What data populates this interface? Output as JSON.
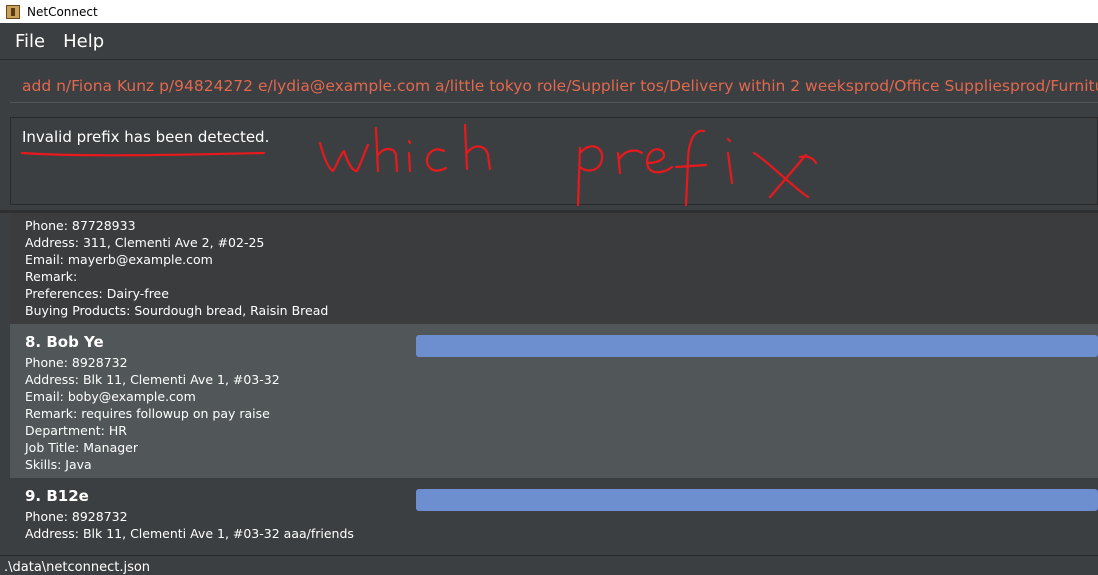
{
  "window": {
    "title": "NetConnect",
    "icon": "netconnect-app-icon"
  },
  "menu": {
    "file": "File",
    "help": "Help"
  },
  "command": {
    "value": "add n/Fiona Kunz p/94824272 e/lydia@example.com a/little tokyo role/Supplier tos/Delivery within 2 weeksprod/Office Suppliesprod/Furniture"
  },
  "result": {
    "message": "Invalid prefix has been detected."
  },
  "annotation": {
    "handwritten": "which prefix"
  },
  "persons": [
    {
      "phone": "Phone: 87728933",
      "address": "Address: 311, Clementi Ave 2, #02-25",
      "email": "Email: mayerb@example.com",
      "remark": "Remark:",
      "preferences": "Preferences: Dairy-free",
      "buying": "Buying Products: Sourdough bread, Raisin Bread"
    },
    {
      "name": "8.  Bob Ye",
      "phone": "Phone: 8928732",
      "address": "Address: Blk 11, Clementi Ave 1, #03-32",
      "email": "Email: boby@example.com",
      "remark": "Remark: requires followup on pay raise",
      "department": "Department: HR",
      "job": "Job Title: Manager",
      "skills": "Skills: Java"
    },
    {
      "name": "9.  B12e",
      "phone": "Phone: 8928732",
      "address": "Address: Blk 11, Clementi Ave 1, #03-32 aaa/friends"
    }
  ],
  "status": {
    "path": ".\\data\\netconnect.json"
  },
  "colors": {
    "command_text": "#e0684f",
    "tag_bar": "#6e8fcf",
    "annotation": "#e8191d"
  }
}
